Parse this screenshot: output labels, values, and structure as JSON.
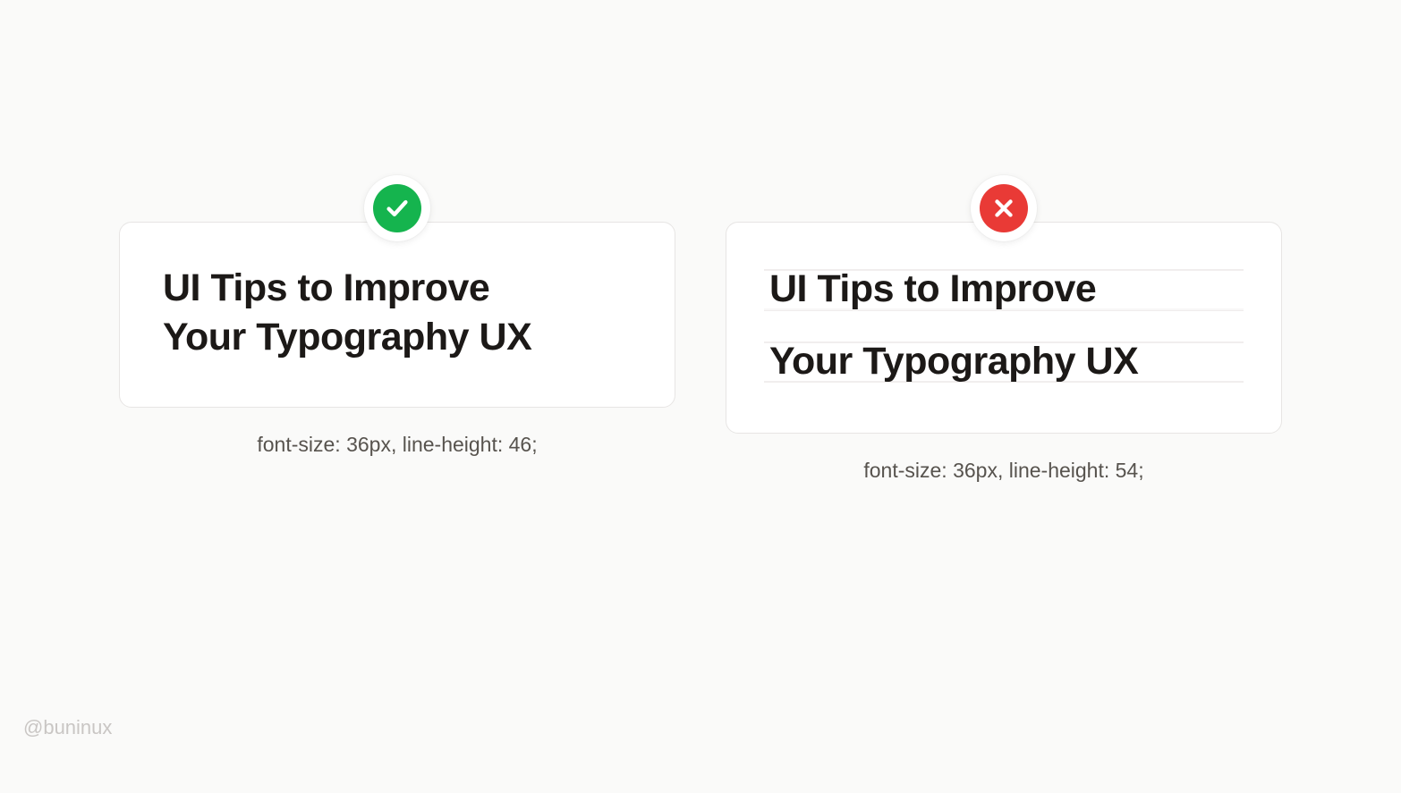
{
  "good": {
    "heading_line1": "UI Tips to Improve",
    "heading_line2": "Your Typography UX",
    "caption": "font-size: 36px, line-height: 46;"
  },
  "bad": {
    "heading_line1": "UI Tips to Improve",
    "heading_line2": "Your Typography UX",
    "caption": "font-size: 36px, line-height: 54;"
  },
  "credit": "@buninux"
}
